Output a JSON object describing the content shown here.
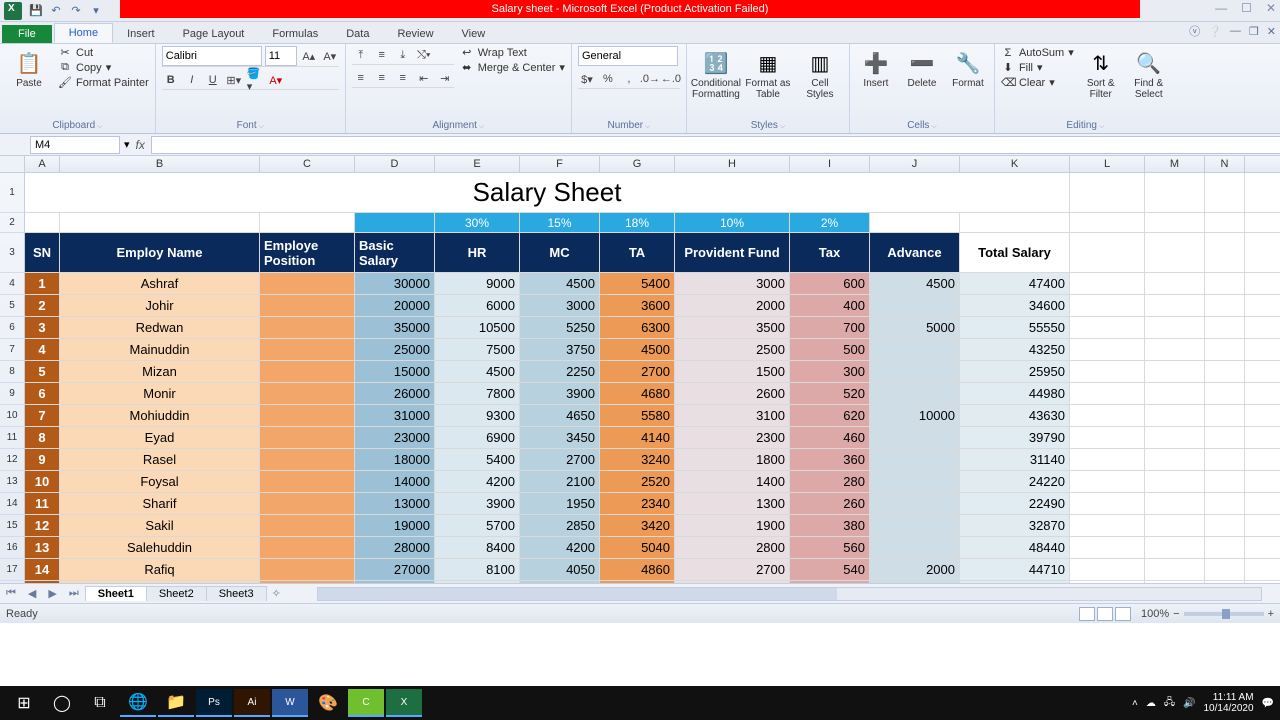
{
  "window": {
    "title": "Salary sheet  -  Microsoft Excel (Product Activation Failed)"
  },
  "ribbon": {
    "tabs": [
      "File",
      "Home",
      "Insert",
      "Page Layout",
      "Formulas",
      "Data",
      "Review",
      "View"
    ],
    "active_tab": "Home",
    "clipboard": {
      "cut": "Cut",
      "copy": "Copy",
      "fp": "Format Painter",
      "paste": "Paste",
      "label": "Clipboard"
    },
    "font": {
      "name": "Calibri",
      "size": "11",
      "label": "Font"
    },
    "alignment": {
      "wrap": "Wrap Text",
      "merge": "Merge & Center",
      "label": "Alignment"
    },
    "number": {
      "format": "General",
      "label": "Number"
    },
    "styles": {
      "cf": "Conditional Formatting",
      "fat": "Format as Table",
      "cs": "Cell Styles",
      "label": "Styles"
    },
    "cells": {
      "insert": "Insert",
      "delete": "Delete",
      "format": "Format",
      "label": "Cells"
    },
    "editing": {
      "sum": "AutoSum",
      "fill": "Fill",
      "clear": "Clear",
      "sort": "Sort & Filter",
      "find": "Find & Select",
      "label": "Editing"
    }
  },
  "namebox": "M4",
  "columns": [
    "A",
    "B",
    "C",
    "D",
    "E",
    "F",
    "G",
    "H",
    "I",
    "J",
    "K",
    "L",
    "M",
    "N"
  ],
  "sheet": {
    "title": "Salary Sheet",
    "percent_row": [
      "",
      "",
      "",
      "",
      "30%",
      "15%",
      "18%",
      "10%",
      "2%",
      "",
      "",
      "",
      "",
      ""
    ],
    "headers": [
      "SN",
      "Employ Name",
      "Employe Position",
      "Basic Salary",
      "HR",
      "MC",
      "TA",
      "Provident Fund",
      "Tax",
      "Advance",
      "Total Salary"
    ],
    "rows": [
      {
        "sn": 1,
        "name": "Ashraf",
        "pos": "",
        "basic": 30000,
        "hr": 9000,
        "mc": 4500,
        "ta": 5400,
        "pf": 3000,
        "tax": 600,
        "adv": 4500,
        "tot": 47400
      },
      {
        "sn": 2,
        "name": "Johir",
        "pos": "",
        "basic": 20000,
        "hr": 6000,
        "mc": 3000,
        "ta": 3600,
        "pf": 2000,
        "tax": 400,
        "adv": "",
        "tot": 34600
      },
      {
        "sn": 3,
        "name": "Redwan",
        "pos": "",
        "basic": 35000,
        "hr": 10500,
        "mc": 5250,
        "ta": 6300,
        "pf": 3500,
        "tax": 700,
        "adv": 5000,
        "tot": 55550
      },
      {
        "sn": 4,
        "name": "Mainuddin",
        "pos": "",
        "basic": 25000,
        "hr": 7500,
        "mc": 3750,
        "ta": 4500,
        "pf": 2500,
        "tax": 500,
        "adv": "",
        "tot": 43250
      },
      {
        "sn": 5,
        "name": "Mizan",
        "pos": "",
        "basic": 15000,
        "hr": 4500,
        "mc": 2250,
        "ta": 2700,
        "pf": 1500,
        "tax": 300,
        "adv": "",
        "tot": 25950
      },
      {
        "sn": 6,
        "name": "Monir",
        "pos": "",
        "basic": 26000,
        "hr": 7800,
        "mc": 3900,
        "ta": 4680,
        "pf": 2600,
        "tax": 520,
        "adv": "",
        "tot": 44980
      },
      {
        "sn": 7,
        "name": "Mohiuddin",
        "pos": "",
        "basic": 31000,
        "hr": 9300,
        "mc": 4650,
        "ta": 5580,
        "pf": 3100,
        "tax": 620,
        "adv": 10000,
        "tot": 43630
      },
      {
        "sn": 8,
        "name": "Eyad",
        "pos": "",
        "basic": 23000,
        "hr": 6900,
        "mc": 3450,
        "ta": 4140,
        "pf": 2300,
        "tax": 460,
        "adv": "",
        "tot": 39790
      },
      {
        "sn": 9,
        "name": "Rasel",
        "pos": "",
        "basic": 18000,
        "hr": 5400,
        "mc": 2700,
        "ta": 3240,
        "pf": 1800,
        "tax": 360,
        "adv": "",
        "tot": 31140
      },
      {
        "sn": 10,
        "name": "Foysal",
        "pos": "",
        "basic": 14000,
        "hr": 4200,
        "mc": 2100,
        "ta": 2520,
        "pf": 1400,
        "tax": 280,
        "adv": "",
        "tot": 24220
      },
      {
        "sn": 11,
        "name": "Sharif",
        "pos": "",
        "basic": 13000,
        "hr": 3900,
        "mc": 1950,
        "ta": 2340,
        "pf": 1300,
        "tax": 260,
        "adv": "",
        "tot": 22490
      },
      {
        "sn": 12,
        "name": "Sakil",
        "pos": "",
        "basic": 19000,
        "hr": 5700,
        "mc": 2850,
        "ta": 3420,
        "pf": 1900,
        "tax": 380,
        "adv": "",
        "tot": 32870
      },
      {
        "sn": 13,
        "name": "Salehuddin",
        "pos": "",
        "basic": 28000,
        "hr": 8400,
        "mc": 4200,
        "ta": 5040,
        "pf": 2800,
        "tax": 560,
        "adv": "",
        "tot": 48440
      },
      {
        "sn": 14,
        "name": "Rafiq",
        "pos": "",
        "basic": 27000,
        "hr": 8100,
        "mc": 4050,
        "ta": 4860,
        "pf": 2700,
        "tax": 540,
        "adv": 2000,
        "tot": 44710
      }
    ]
  },
  "tabs_bottom": [
    "Sheet1",
    "Sheet2",
    "Sheet3"
  ],
  "status": {
    "ready": "Ready",
    "zoom": "100%"
  },
  "clock": {
    "time": "11:11 AM",
    "date": "10/14/2020"
  }
}
